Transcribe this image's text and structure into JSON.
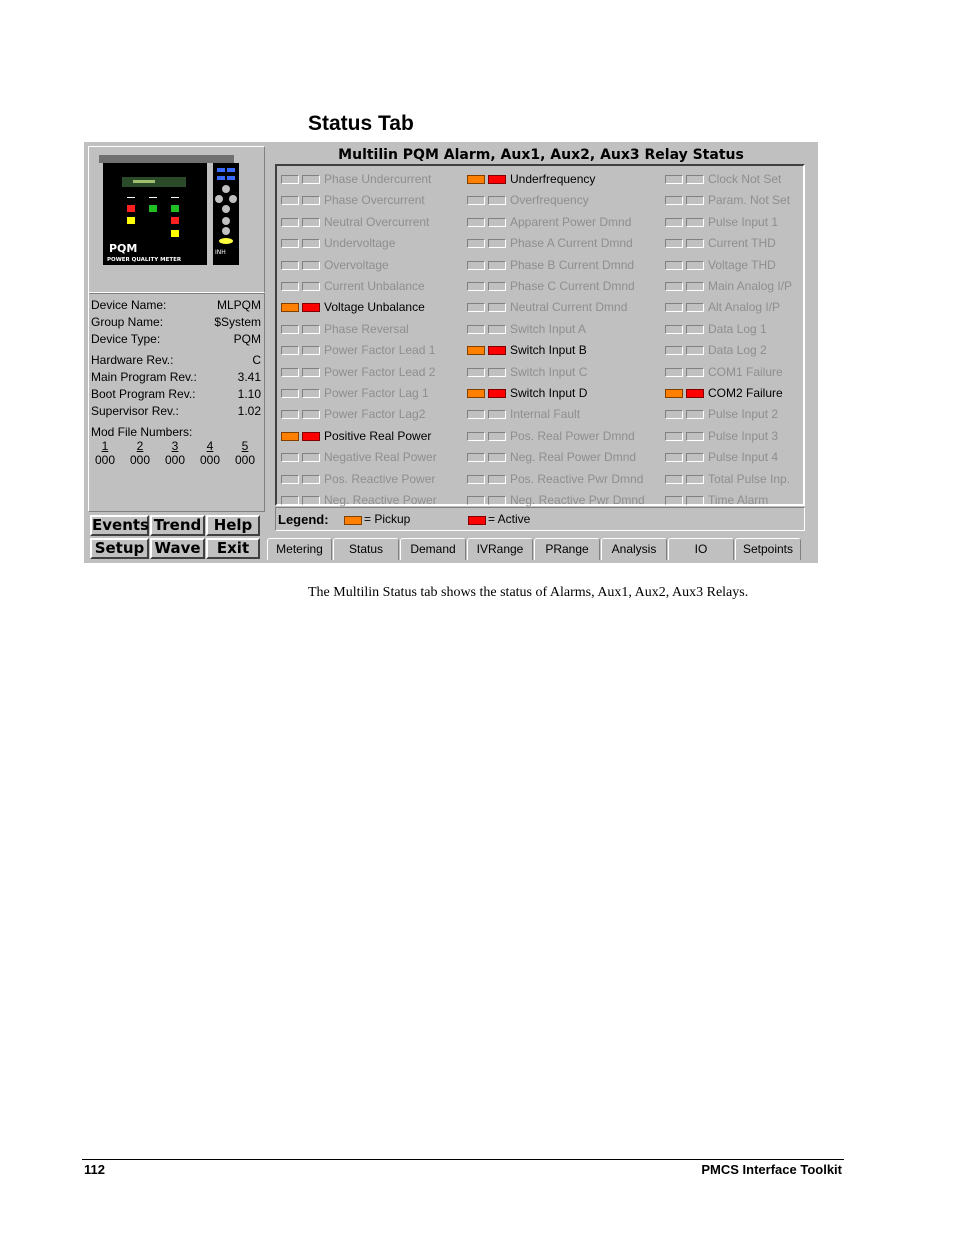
{
  "heading": "Status Tab",
  "device": {
    "logo": "PQM",
    "logo_sub": "POWER QUALITY METER",
    "inh": "INH",
    "info": [
      {
        "label": "Device Name:",
        "value": "MLPQM"
      },
      {
        "label": "Group Name:",
        "value": "$System"
      },
      {
        "label": "Device Type:",
        "value": "PQM"
      },
      {
        "label": "Hardware Rev.:",
        "value": "C"
      },
      {
        "label": "Main Program Rev.:",
        "value": "3.41"
      },
      {
        "label": "Boot Program Rev.:",
        "value": "1.10"
      },
      {
        "label": "Supervisor Rev.:",
        "value": "1.02"
      }
    ],
    "mod_label": "Mod File Numbers:",
    "mods": [
      {
        "n": "1",
        "v": "000"
      },
      {
        "n": "2",
        "v": "000"
      },
      {
        "n": "3",
        "v": "000"
      },
      {
        "n": "4",
        "v": "000"
      },
      {
        "n": "5",
        "v": "000"
      }
    ]
  },
  "buttons": [
    "Events",
    "Trend",
    "Help",
    "Setup",
    "Wave",
    "Exit"
  ],
  "status_title": "Multilin PQM Alarm, Aux1, Aux2, Aux3 Relay Status",
  "columns": [
    [
      {
        "label": "Phase Undercurrent",
        "state": "off"
      },
      {
        "label": "Phase Overcurrent",
        "state": "off"
      },
      {
        "label": "Neutral Overcurrent",
        "state": "off"
      },
      {
        "label": "Undervoltage",
        "state": "off"
      },
      {
        "label": "Overvoltage",
        "state": "off"
      },
      {
        "label": "Current Unbalance",
        "state": "off"
      },
      {
        "label": "Voltage Unbalance",
        "state": "active"
      },
      {
        "label": "Phase Reversal",
        "state": "off"
      },
      {
        "label": "Power Factor Lead 1",
        "state": "off"
      },
      {
        "label": "Power Factor Lead 2",
        "state": "off"
      },
      {
        "label": "Power Factor Lag 1",
        "state": "off"
      },
      {
        "label": "Power Factor Lag2",
        "state": "off"
      },
      {
        "label": "Positive Real Power",
        "state": "active"
      },
      {
        "label": "Negative Real Power",
        "state": "off"
      },
      {
        "label": "Pos. Reactive Power",
        "state": "off"
      },
      {
        "label": "Neg. Reactive Power",
        "state": "off"
      }
    ],
    [
      {
        "label": "Underfrequency",
        "state": "active"
      },
      {
        "label": "Overfrequency",
        "state": "off"
      },
      {
        "label": "Apparent Power Dmnd",
        "state": "off"
      },
      {
        "label": "Phase A Current Dmnd",
        "state": "off"
      },
      {
        "label": "Phase B Current Dmnd",
        "state": "off"
      },
      {
        "label": "Phase C Current Dmnd",
        "state": "off"
      },
      {
        "label": "Neutral Current Dmnd",
        "state": "off"
      },
      {
        "label": "Switch Input A",
        "state": "off"
      },
      {
        "label": "Switch Input B",
        "state": "active"
      },
      {
        "label": "Switch Input C",
        "state": "off"
      },
      {
        "label": "Switch Input D",
        "state": "active"
      },
      {
        "label": "Internal Fault",
        "state": "off"
      },
      {
        "label": "Pos. Real Power Dmnd",
        "state": "off"
      },
      {
        "label": "Neg. Real Power Dmnd",
        "state": "off"
      },
      {
        "label": "Pos. Reactive Pwr Dmnd",
        "state": "off"
      },
      {
        "label": "Neg. Reactive Pwr Dmnd",
        "state": "off"
      }
    ],
    [
      {
        "label": "Clock Not Set",
        "state": "off"
      },
      {
        "label": "Param. Not Set",
        "state": "off"
      },
      {
        "label": "Pulse Input 1",
        "state": "off"
      },
      {
        "label": "Current THD",
        "state": "off"
      },
      {
        "label": "Voltage THD",
        "state": "off"
      },
      {
        "label": "Main Analog I/P",
        "state": "off"
      },
      {
        "label": "Alt Analog I/P",
        "state": "off"
      },
      {
        "label": "Data Log 1",
        "state": "off"
      },
      {
        "label": "Data Log 2",
        "state": "off"
      },
      {
        "label": "COM1 Failure",
        "state": "off"
      },
      {
        "label": "COM2 Failure",
        "state": "active"
      },
      {
        "label": "Pulse Input 2",
        "state": "off"
      },
      {
        "label": "Pulse Input 3",
        "state": "off"
      },
      {
        "label": "Pulse Input 4",
        "state": "off"
      },
      {
        "label": "Total Pulse Inp.",
        "state": "off"
      },
      {
        "label": "Time Alarm",
        "state": "off"
      }
    ]
  ],
  "legend": {
    "title": "Legend:",
    "pickup": "= Pickup",
    "active": "= Active"
  },
  "tabs": [
    "Metering",
    "Status",
    "Demand",
    "IVRange",
    "PRange",
    "Analysis",
    "IO",
    "Setpoints"
  ],
  "colors": {
    "pickup": "#ff8000",
    "active": "#ff0000",
    "panel": "#c0c0c0",
    "inactive_text": "#8e8e8e"
  },
  "caption": "The Multilin Status tab shows the status of Alarms, Aux1, Aux2, Aux3 Relays.",
  "footer": {
    "page": "112",
    "title": "PMCS Interface Toolkit"
  }
}
